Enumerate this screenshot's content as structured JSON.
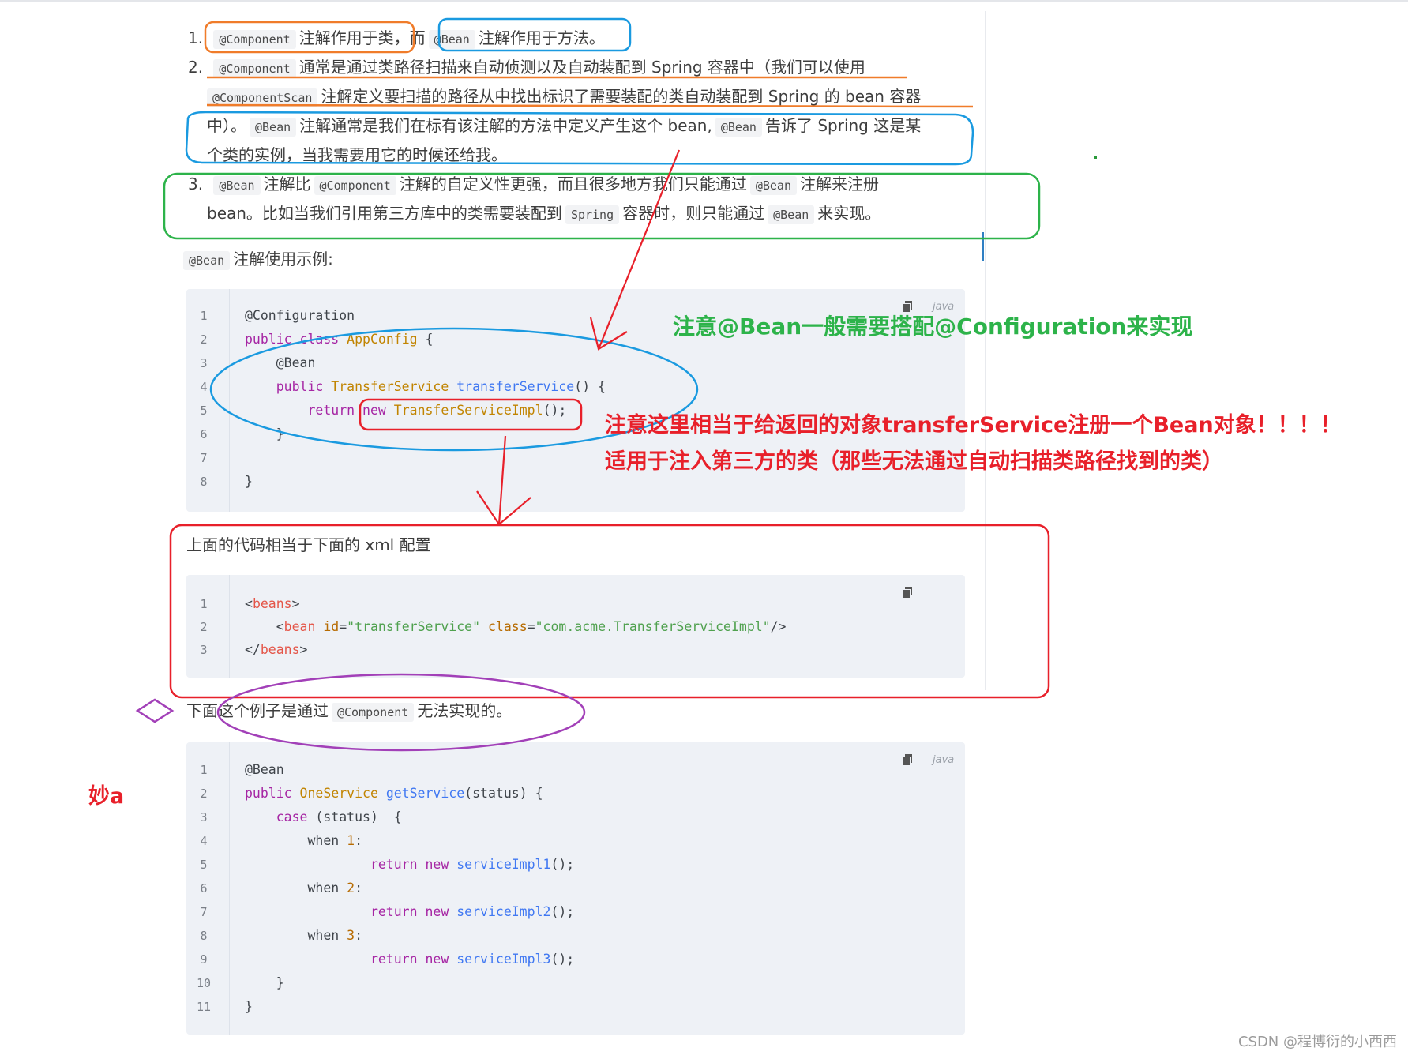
{
  "list": {
    "item1": {
      "num": "1.",
      "code_component": "@Component",
      "text_a": "注解作用于类，而",
      "code_bean": "@Bean",
      "text_b": "注解作用于方法。"
    },
    "item2": {
      "num": "2.",
      "code_component": "@Component",
      "text_a": "通常是通过类路径扫描来自动侦测以及自动装配到 Spring 容器中（我们可以使用",
      "code_scan": "@ComponentScan",
      "text_b": "注解定义要扫描的路径从中找出标识了需要装配的类自动装配到 Spring 的 bean 容器",
      "text_c": "中）。",
      "code_bean": "@Bean",
      "text_d": "注解通常是我们在标有该注解的方法中定义产生这个 bean,",
      "code_bean2": "@Bean",
      "text_e": "告诉了 Spring 这是某",
      "text_f": "个类的实例，当我需要用它的时候还给我。"
    },
    "item3": {
      "num": "3.",
      "code_bean": "@Bean",
      "text_a": "注解比",
      "code_component": "@Component",
      "text_b": "注解的自定义性更强，而且很多地方我们只能通过",
      "code_bean2": "@Bean",
      "text_c": "注解来注册",
      "text_d": "bean。比如当我们引用第三方库中的类需要装配到",
      "code_spring": "Spring",
      "text_e": "容器时，则只能通过",
      "code_bean3": "@Bean",
      "text_f": "来实现。"
    }
  },
  "example_intro": {
    "code": "@Bean",
    "text": "注解使用示例:"
  },
  "code1": {
    "lang": "java",
    "lines": [
      "1",
      "2",
      "3",
      "4",
      "5",
      "6",
      "7",
      "8"
    ],
    "l1": "@Configuration",
    "l2_kw": "public class",
    "l2_name": " AppConfig",
    "l2_rest": " {",
    "l3": "    @Bean",
    "l4_kw": "    public",
    "l4_type": " TransferService",
    "l4_fn": " transferService",
    "l4_rest": "() {",
    "l5_kw": "        return",
    "l5_new": " new",
    "l5_type": " TransferServiceImpl",
    "l5_rest": "();",
    "l6": "    }",
    "l7": "",
    "l8": "}"
  },
  "xml_intro": "上面的代码相当于下面的 xml 配置",
  "code2": {
    "lines": [
      "1",
      "2",
      "3"
    ],
    "l1_open": "<",
    "l1_tag": "beans",
    "l1_close": ">",
    "l2_open": "    <",
    "l2_tag": "bean",
    "l2_attr1": " id",
    "l2_eq1": "=",
    "l2_val1": "\"transferService\"",
    "l2_attr2": " class",
    "l2_eq2": "=",
    "l2_val2": "\"com.acme.TransferServiceImpl\"",
    "l2_end": "/>",
    "l3_open": "</",
    "l3_tag": "beans",
    "l3_close": ">"
  },
  "component_intro": {
    "text_a": "下面这个例子是通过",
    "code": "@Component",
    "text_b": "无法实现的。"
  },
  "code3": {
    "lang": "java",
    "lines": [
      "1",
      "2",
      "3",
      "4",
      "5",
      "6",
      "7",
      "8",
      "9",
      "10",
      "11"
    ],
    "l1": "@Bean",
    "l2_kw": "public",
    "l2_type": " OneService",
    "l2_fn": " getService",
    "l2_rest": "(status) {",
    "l3_kw": "    case",
    "l3_rest": " (status)  {",
    "l4_a": "        when ",
    "l4_n": "1",
    "l4_b": ":",
    "l5_kw": "                return new",
    "l5_fn": " serviceImpl1",
    "l5_rest": "();",
    "l6_a": "        when ",
    "l6_n": "2",
    "l6_b": ":",
    "l7_kw": "                return new",
    "l7_fn": " serviceImpl2",
    "l7_rest": "();",
    "l8_a": "        when ",
    "l8_n": "3",
    "l8_b": ":",
    "l9_kw": "                return new",
    "l9_fn": " serviceImpl3",
    "l9_rest": "();",
    "l10": "    }",
    "l11": "}"
  },
  "annotations": {
    "green_note": "注意@Bean一般需要搭配@Configuration来实现",
    "red_note1": "注意这里相当于给返回的对象transferService注册一个Bean对象！！！！",
    "red_note2": "适用于注入第三方的类（那些无法通过自动扫描类路径找到的类）",
    "side_note": "妙a"
  },
  "watermark": "CSDN @程博衍的小西西",
  "colors": {
    "orange": "#f07c2a",
    "blue": "#1a9ae0",
    "green": "#2db34a",
    "red": "#e8202a",
    "purple": "#a240b8",
    "code_bg": "#eef1f6"
  }
}
